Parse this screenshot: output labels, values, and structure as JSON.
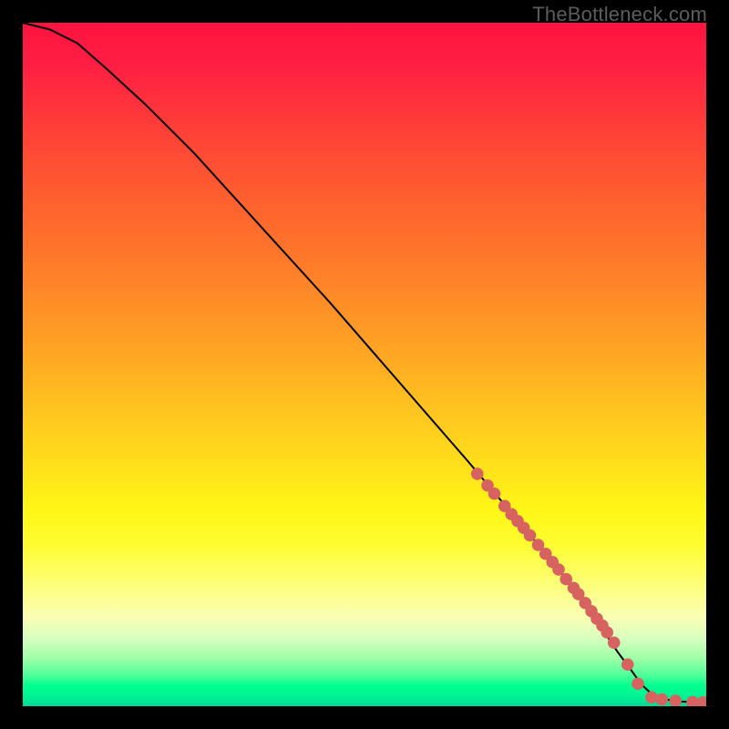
{
  "watermark": "TheBottleneck.com",
  "chart_data": {
    "type": "line",
    "title": "",
    "xlabel": "",
    "ylabel": "",
    "xlim": [
      0,
      100
    ],
    "ylim": [
      0,
      100
    ],
    "series": [
      {
        "name": "curve",
        "x": [
          0,
          4,
          8,
          12,
          18,
          25,
          35,
          45,
          55,
          65,
          73,
          78,
          82,
          85,
          87,
          89,
          90.5,
          92,
          94,
          96,
          98,
          100
        ],
        "values": [
          100,
          99,
          97,
          93.5,
          88,
          81,
          70,
          59,
          47.5,
          36,
          26.5,
          20.5,
          15,
          11,
          8,
          5.3,
          3.2,
          1.8,
          1.0,
          0.7,
          0.6,
          0.55
        ]
      },
      {
        "name": "dotted-segment",
        "x": [
          66.5,
          68,
          69,
          70.5,
          71.5,
          72.4,
          73.3,
          74.2,
          75.4,
          76.5,
          77.5,
          78.4,
          79.5,
          80.6,
          81.3,
          82.3,
          83.2,
          84.0,
          84.8,
          85.5,
          86.5,
          88.5,
          90.0,
          92.0,
          93.5,
          95.5,
          98.0,
          99.5
        ],
        "values": [
          34.0,
          32.3,
          31.1,
          29.3,
          28.1,
          27.1,
          26.1,
          25.0,
          23.6,
          22.3,
          21.1,
          20.0,
          18.6,
          17.3,
          16.4,
          15.1,
          13.9,
          12.8,
          11.8,
          10.8,
          9.3,
          6.1,
          3.3,
          1.3,
          1.0,
          0.8,
          0.6,
          0.55
        ]
      }
    ],
    "colors": {
      "curve": "#000000",
      "dots": "#d66360"
    }
  }
}
